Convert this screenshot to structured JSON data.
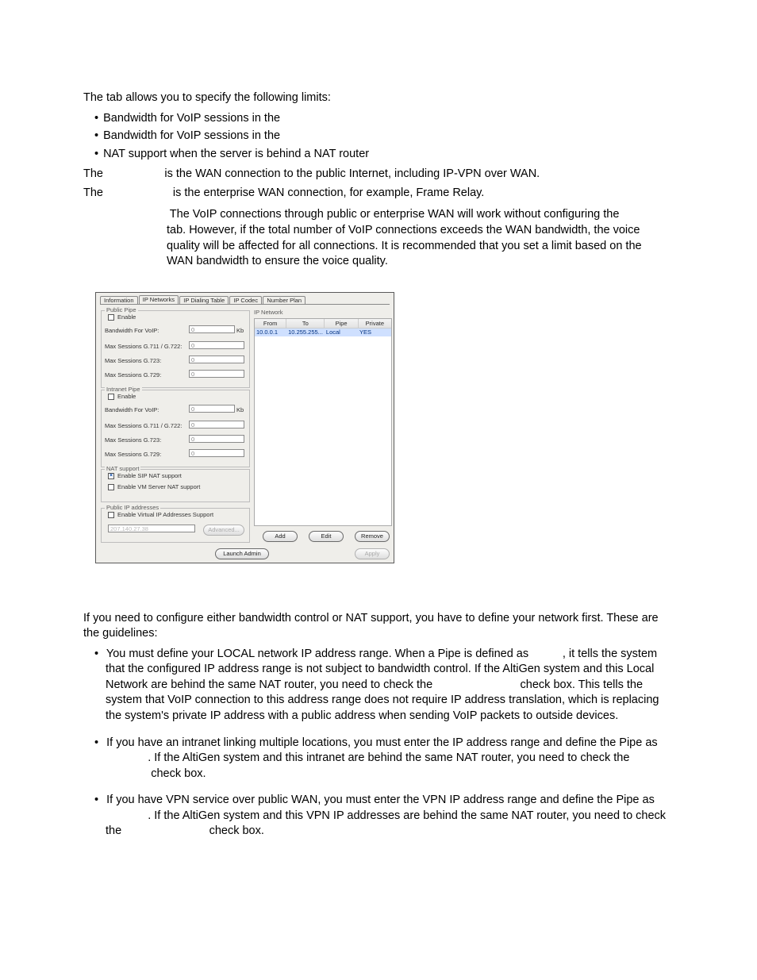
{
  "p1": {
    "pre": "The tab allows you to specify the following limits:"
  },
  "bl1": {
    "a": "Bandwidth for VoIP sessions in the",
    "b": "Bandwidth for VoIP sessions in the",
    "c": "NAT support when the server is behind a NAT router"
  },
  "p2": {
    "a": "The",
    "b": " is the WAN connection to the public Internet, including IP-VPN over WAN."
  },
  "p3": {
    "a": "The",
    "b": " is the enterprise WAN connection, for example, Frame Relay."
  },
  "note": {
    "head": "",
    "l1": "The VoIP connections through public or enterprise WAN will work without configuring the",
    "l2": " tab. However, if the total number of VoIP connections exceeds the WAN bandwidth, the voice quality will be affected for all connections. It is recommended that you set a limit based on the WAN bandwidth to ensure the voice quality."
  },
  "scr": {
    "tabs": {
      "t1": "Information",
      "t2": "IP Networks",
      "t3": "IP Dialing Table",
      "t4": "IP Codec",
      "t5": "Number Plan"
    },
    "pub": {
      "title": "Public Pipe",
      "enable": "Enable",
      "bw": "Bandwidth For VoIP:",
      "bwv": "0",
      "kb": "Kb",
      "g711": "Max Sessions G.711 / G.722:",
      "g711v": "0",
      "g723": "Max Sessions G.723:",
      "g723v": "0",
      "g729": "Max Sessions G.729:",
      "g729v": "0"
    },
    "intr": {
      "title": "Intranet Pipe",
      "enable": "Enable",
      "bw": "Bandwidth For VoIP:",
      "bwv": "0",
      "kb": "Kb",
      "g711": "Max Sessions G.711 / G.722:",
      "g711v": "0",
      "g723": "Max Sessions G.723:",
      "g723v": "0",
      "g729": "Max Sessions G.729:",
      "g729v": "0"
    },
    "nat": {
      "title": "NAT support",
      "sip": "Enable SIP NAT support",
      "vm": "Enable VM Server NAT support"
    },
    "pubip": {
      "title": "Public IP addresses",
      "virt": "Enable Virtual IP Addresses Support",
      "addr": "207.140.27.38",
      "adv": "Advanced..."
    },
    "net": {
      "title": "IP Network",
      "h1": "From",
      "h2": "To",
      "h3": "Pipe",
      "h4": "Private",
      "r1c1": "10.0.0.1",
      "r1c2": "10.255.255...",
      "r1c3": "Local",
      "r1c4": "YES"
    },
    "btns": {
      "add": "Add",
      "edit": "Edit",
      "remove": "Remove",
      "launch": "Launch Admin",
      "apply": "Apply"
    }
  },
  "p4": "If you need to configure either bandwidth control or NAT support, you have to define your network first. These are the guidelines:",
  "bl2": {
    "a1": "You must define your LOCAL network IP address range. When a Pipe is defined as ",
    "a2": ", it tells the sys­tem that the configured IP address range is not subject to bandwidth control. If the AltiGen system and this Local Network are behind the same NAT router, you need to check the ",
    "a3": " check box. This tells the system that VoIP connection to this address range does not require IP address translation, which is replacing the system's private IP address with a public address when sending VoIP packets to outside devices.",
    "b1": "If you have an intranet linking multiple locations, you must enter the IP address range and define the Pipe as ",
    "b2": ". If the AltiGen system and this intranet are behind the same NAT router, you need to check the ",
    "b3": " check box.",
    "c1": "If you have VPN service over public WAN, you must enter the VPN IP address range and define the Pipe as ",
    "c2": ". If the AltiGen system and this VPN IP addresses are behind the same NAT router, you need to check the ",
    "c3": " check box."
  }
}
